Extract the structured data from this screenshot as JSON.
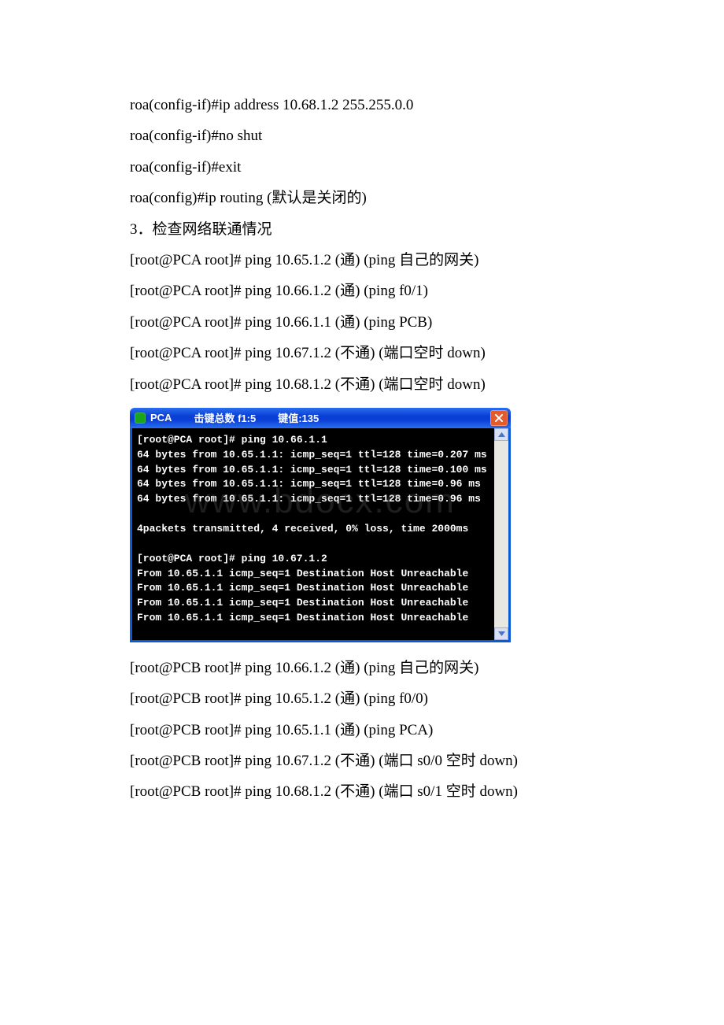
{
  "doc": {
    "lines_before": [
      "roa(config-if)#ip address 10.68.1.2 255.255.0.0",
      "roa(config-if)#no shut",
      "roa(config-if)#exit",
      "roa(config)#ip routing (默认是关闭的)",
      "3．检查网络联通情况",
      "[root@PCA root]# ping 10.65.1.2 (通) (ping 自己的网关)",
      "[root@PCA root]# ping 10.66.1.2 (通) (ping f0/1)",
      "[root@PCA root]# ping 10.66.1.1 (通) (ping PCB)",
      "[root@PCA root]# ping 10.67.1.2 (不通) (端口空时 down)",
      "[root@PCA root]# ping 10.68.1.2 (不通) (端口空时 down)"
    ],
    "lines_after": [
      "[root@PCB root]# ping 10.66.1.2 (通) (ping 自己的网关)",
      "[root@PCB root]# ping 10.65.1.2 (通) (ping f0/0)",
      "[root@PCB root]# ping 10.65.1.1 (通) (ping PCA)",
      "[root@PCB root]# ping 10.67.1.2 (不通) (端口 s0/0 空时 down)",
      "[root@PCB root]# ping 10.68.1.2 (不通) (端口 s0/1 空时 down)"
    ]
  },
  "terminal": {
    "title_app": "PCA",
    "title_keys_label": "击键总数 f1:5",
    "title_value_label": "键值:135",
    "lines": [
      "[root@PCA root]# ping 10.66.1.1",
      "64 bytes from 10.65.1.1: icmp_seq=1 ttl=128 time=0.207 ms",
      "64 bytes from 10.65.1.1: icmp_seq=1 ttl=128 time=0.100 ms",
      "64 bytes from 10.65.1.1: icmp_seq=1 ttl=128 time=0.96 ms",
      "64 bytes from 10.65.1.1: icmp_seq=1 ttl=128 time=0.96 ms",
      "",
      "4packets transmitted, 4 received, 0% loss, time 2000ms",
      "",
      "[root@PCA root]# ping 10.67.1.2",
      "From 10.65.1.1 icmp_seq=1 Destination Host Unreachable",
      "From 10.65.1.1 icmp_seq=1 Destination Host Unreachable",
      "From 10.65.1.1 icmp_seq=1 Destination Host Unreachable",
      "From 10.65.1.1 icmp_seq=1 Destination Host Unreachable"
    ]
  },
  "watermark": "www.bdocx.com"
}
